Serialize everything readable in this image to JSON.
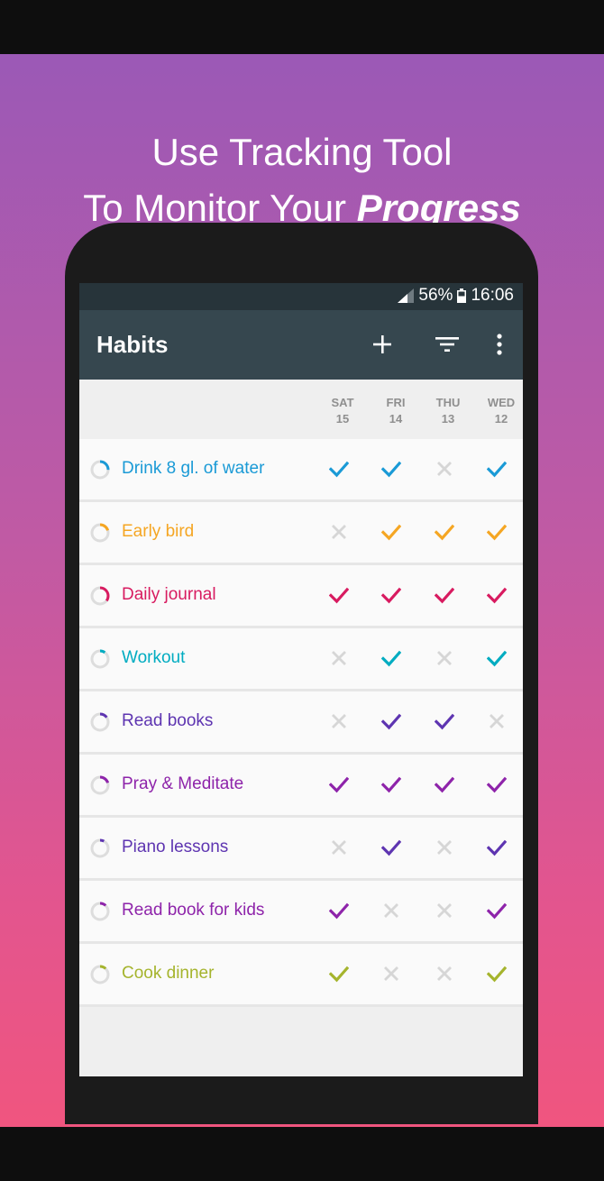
{
  "promo": {
    "line1": "Use Tracking Tool",
    "line2_prefix": "To Monitor Your ",
    "line2_emphasis": "Progress"
  },
  "status_bar": {
    "battery": "56%",
    "time": "16:06",
    "signal_icon": "signal-icon",
    "battery_icon": "battery-icon"
  },
  "app_bar": {
    "title": "Habits",
    "actions": [
      "add-icon",
      "filter-icon",
      "more-vert-icon"
    ]
  },
  "columns": [
    {
      "day": "SAT",
      "date": "15"
    },
    {
      "day": "FRI",
      "date": "14"
    },
    {
      "day": "THU",
      "date": "13"
    },
    {
      "day": "WED",
      "date": "12"
    }
  ],
  "colors": {
    "inactive_mark": "#d6d6d6",
    "ring_track": "#dddddd",
    "app_bar": "#36474f",
    "status_bar": "#27343a"
  },
  "habits": [
    {
      "name": "Drink 8 gl. of water",
      "color": "#1a9ad6",
      "progress": 0.25,
      "marks": [
        true,
        true,
        false,
        true
      ]
    },
    {
      "name": "Early bird",
      "color": "#f5a623",
      "progress": 0.2,
      "marks": [
        false,
        true,
        true,
        true
      ]
    },
    {
      "name": "Daily journal",
      "color": "#d81b60",
      "progress": 0.35,
      "marks": [
        true,
        true,
        true,
        true
      ]
    },
    {
      "name": "Workout",
      "color": "#00acc1",
      "progress": 0.1,
      "marks": [
        false,
        true,
        false,
        true
      ]
    },
    {
      "name": "Read books",
      "color": "#5e35b1",
      "progress": 0.15,
      "marks": [
        false,
        true,
        true,
        false
      ]
    },
    {
      "name": "Pray & Meditate",
      "color": "#8e24aa",
      "progress": 0.2,
      "marks": [
        true,
        true,
        true,
        true
      ]
    },
    {
      "name": "Piano lessons",
      "color": "#5e35b1",
      "progress": 0.08,
      "marks": [
        false,
        true,
        false,
        true
      ]
    },
    {
      "name": "Read book for kids",
      "color": "#8e24aa",
      "progress": 0.12,
      "marks": [
        true,
        false,
        false,
        true
      ]
    },
    {
      "name": "Cook dinner",
      "color": "#a5b42d",
      "progress": 0.12,
      "marks": [
        true,
        false,
        false,
        true
      ]
    }
  ]
}
